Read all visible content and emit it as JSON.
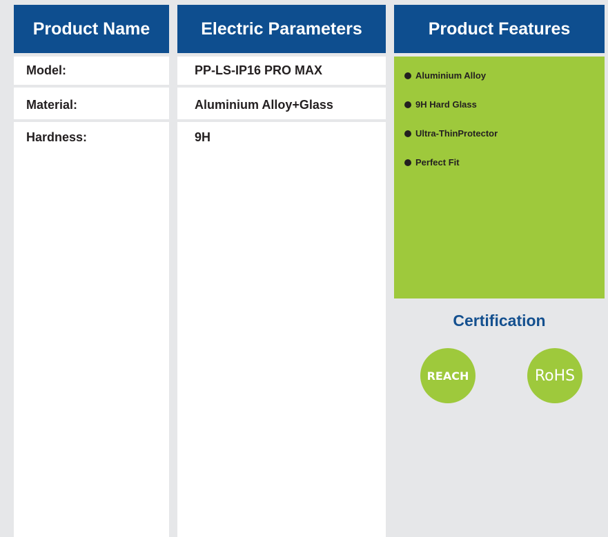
{
  "headers": {
    "product_name": "Product Name",
    "electric_parameters": "Electric Parameters",
    "product_features": "Product Features"
  },
  "rows": [
    {
      "label": "Model:",
      "value": "PP-LS-IP16 PRO MAX"
    },
    {
      "label": "Material:",
      "value": "Aluminium Alloy+Glass"
    },
    {
      "label": "Hardness:",
      "value": "9H"
    }
  ],
  "features": [
    "Aluminium Alloy",
    "9H Hard Glass",
    "Ultra-ThinProtector",
    "Perfect Fit"
  ],
  "certification": {
    "title": "Certification",
    "badges": [
      "REACH",
      "RoHS"
    ]
  },
  "colors": {
    "header_bg": "#0e4e8f",
    "accent_green": "#9ec93c",
    "cert_title": "#14508f",
    "page_bg": "#e6e7e9"
  }
}
